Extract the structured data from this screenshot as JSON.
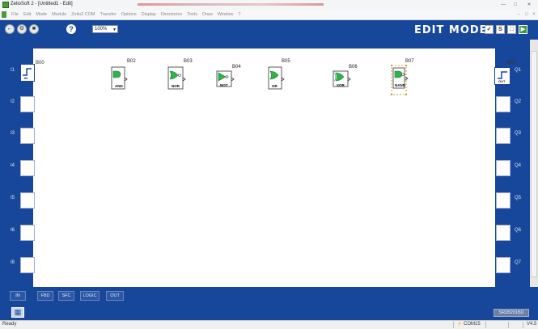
{
  "window": {
    "title": "ZelioSoft 2 - [Untitled1 - Edit]"
  },
  "menu": {
    "items": [
      "File",
      "Edit",
      "Mode",
      "Module",
      "Zelio2 COM",
      "Transfer",
      "Options",
      "Display",
      "Directories",
      "Tools",
      "Draw",
      "Window",
      "?"
    ]
  },
  "toolbar": {
    "zoom_value": "100%",
    "mode_label": "EDIT MODE",
    "help_label": "?"
  },
  "inputs": {
    "labels": [
      "I1",
      "I2",
      "I3",
      "I4",
      "I5",
      "I6",
      "I8"
    ],
    "first_block_id": "B00",
    "first_block_tag": "IN"
  },
  "outputs": {
    "labels": [
      "Q1",
      "Q2",
      "Q3",
      "Q4",
      "Q5",
      "Q6",
      "Q7"
    ],
    "first_block_id": "B01",
    "first_block_tag": "OUT"
  },
  "blocks": [
    {
      "id": "B02",
      "tag": "AND"
    },
    {
      "id": "B03",
      "tag": "NOR"
    },
    {
      "id": "B04",
      "tag": "NOT"
    },
    {
      "id": "B05",
      "tag": "OR"
    },
    {
      "id": "B06",
      "tag": "XOR"
    },
    {
      "id": "B07",
      "tag": "NAND"
    }
  ],
  "tabs": [
    "IN",
    "FBD",
    "SFC",
    "LOGIC",
    "OUT"
  ],
  "bottom": {
    "serial": "SR2B201BD"
  },
  "status": {
    "left": "Ready",
    "com": "COM15",
    "version": "V4.5"
  }
}
